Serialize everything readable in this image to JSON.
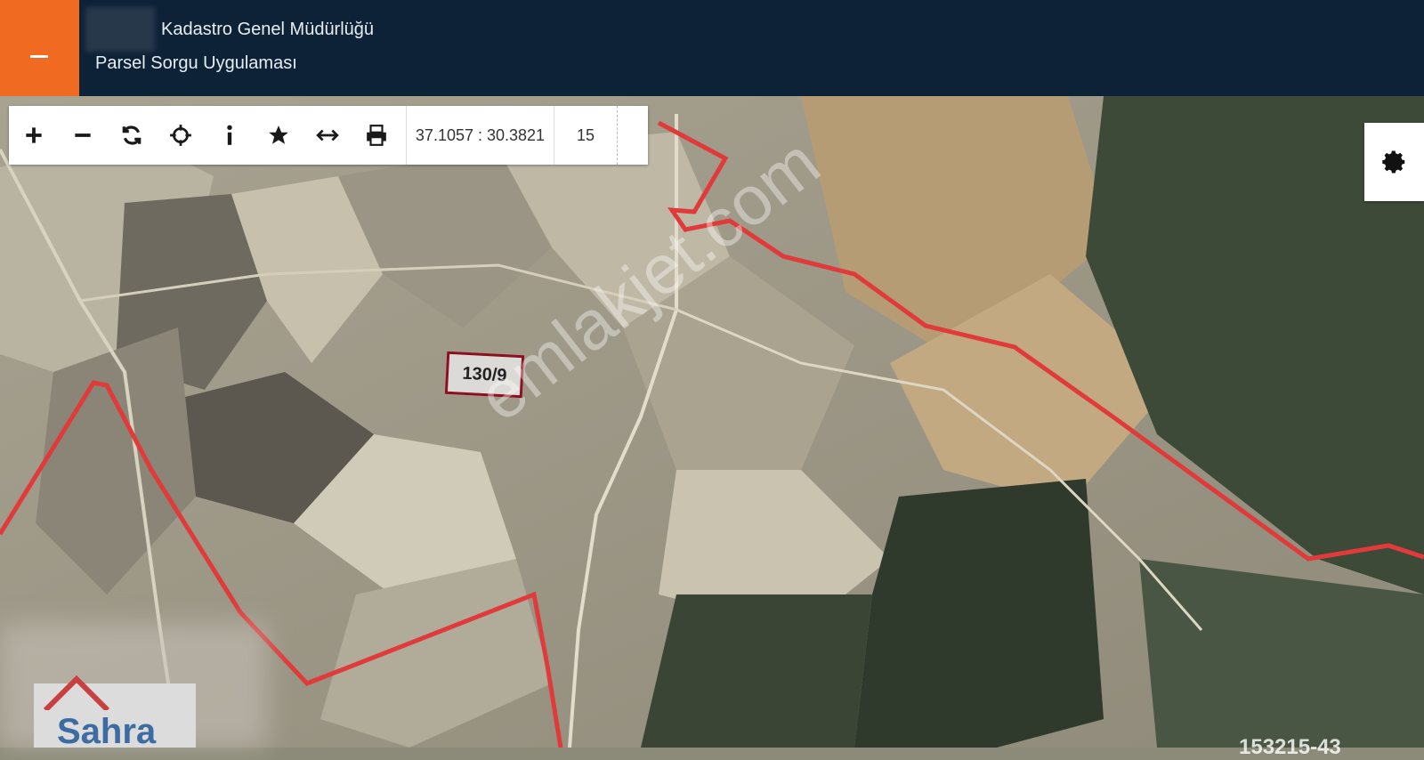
{
  "header": {
    "title": "Kadastro Genel Müdürlüğü",
    "subtitle": "Parsel Sorgu Uygulaması"
  },
  "toolbar": {
    "coordinates": "37.1057 : 30.3821",
    "zoom_level": "15"
  },
  "map": {
    "parcel_label": "130/9",
    "watermark": "emlakjet.com",
    "brand": "Sahra",
    "bottom_id": "153215-43"
  },
  "colors": {
    "header_bg": "#0e2237",
    "menu_accent": "#f06a22",
    "boundary_line": "#e03a3a",
    "parcel_border": "#8b1020"
  }
}
